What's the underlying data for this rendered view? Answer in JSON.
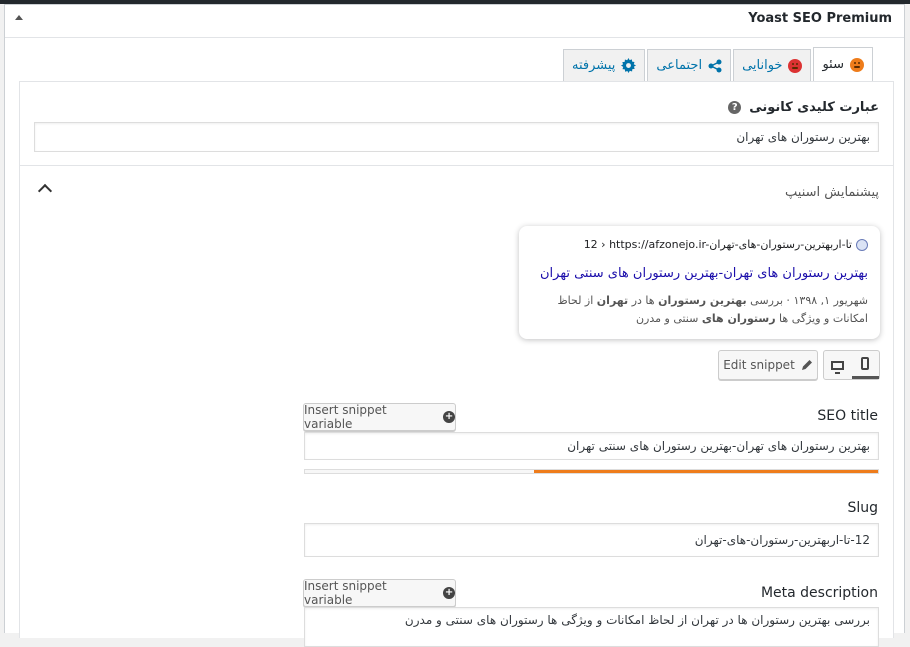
{
  "metabox": {
    "title": "Yoast SEO Premium"
  },
  "tabs": [
    {
      "label": "سئو",
      "icon": "orange-face-icon",
      "active": true
    },
    {
      "label": "خوانایی",
      "icon": "red-face-icon",
      "active": false
    },
    {
      "label": "اجتماعی",
      "icon": "share-icon",
      "active": false
    },
    {
      "label": "پیشرفته",
      "icon": "gear-icon",
      "active": false
    }
  ],
  "focus_keyphrase": {
    "label": "عبارت کلیدی کانونی",
    "help": "?",
    "value": "بهترین رستوران های تهران"
  },
  "snippet_preview": {
    "label": "پیشنمایش اسنیپ",
    "url": "12 › https://afzonejo.ir-تا-اربهترین-رستوران-های-تهران",
    "title": "بهترین رستوران های تهران-بهترین رستوران های سنتی تهران",
    "description_parts": [
      {
        "text": "شهریور ۱, ۱۳۹۸ ⋅ بررسی ",
        "bold": false
      },
      {
        "text": "بهترین رستوران",
        "bold": true
      },
      {
        "text": " ها در ",
        "bold": false
      },
      {
        "text": "تهران",
        "bold": true
      },
      {
        "text": " از لحاظ امکانات و ویژگی ها ",
        "bold": false
      },
      {
        "text": "رستوران های",
        "bold": true
      },
      {
        "text": " سنتی و مدرن",
        "bold": false
      }
    ]
  },
  "controls": {
    "edit_snippet": "Edit snippet",
    "insert_variable": "Insert snippet variable",
    "plus": "+"
  },
  "seo_title": {
    "label": "SEO title",
    "value": "بهترین رستوران های تهران-بهترین رستوران های سنتی تهران",
    "progress": 0.6,
    "progress_color": "#ee7c1b"
  },
  "slug": {
    "label": "Slug",
    "value": "12-تا-اربهترین-رستوران-های-تهران"
  },
  "meta_description": {
    "label": "Meta description",
    "value": "بررسی  بهترین رستوران ها در تهران از لحاظ امکانات و ویژگی ها رستوران های سنتی و مدرن"
  }
}
